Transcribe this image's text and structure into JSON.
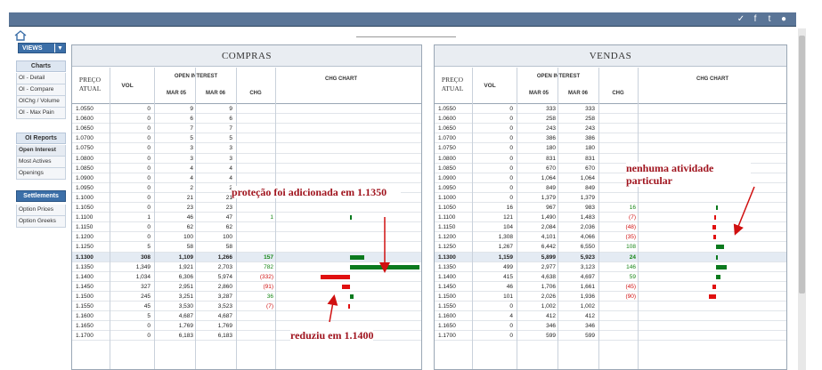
{
  "topbar": {
    "icons": [
      "check-icon",
      "facebook-icon",
      "twitter-icon",
      "rss-icon"
    ]
  },
  "sidebar": {
    "views_label": "VIEWS",
    "charts_head": "Charts",
    "charts": [
      "OI - Detail",
      "OI - Compare",
      "OIChg / Volume",
      "OI - Max Pain"
    ],
    "reports_head": "OI Reports",
    "reports": [
      "Open Interest",
      "Most Actives",
      "Openings"
    ],
    "settle_head": "Settlements",
    "settle": [
      "Option Prices",
      "Option Greeks"
    ]
  },
  "compras": {
    "title": "COMPRAS",
    "headers": {
      "preco": "PREÇO ATUAL",
      "vol": "VOL",
      "oi": "OPEN INTEREST",
      "m1": "MAR 05",
      "m2": "MAR 06",
      "chg": "CHG",
      "chart": "CHG CHART"
    },
    "rows": [
      [
        "1.0550",
        "0",
        "9",
        "9",
        ""
      ],
      [
        "1.0600",
        "0",
        "6",
        "6",
        ""
      ],
      [
        "1.0650",
        "0",
        "7",
        "7",
        ""
      ],
      [
        "1.0700",
        "0",
        "5",
        "5",
        ""
      ],
      [
        "1.0750",
        "0",
        "3",
        "3",
        ""
      ],
      [
        "1.0800",
        "0",
        "3",
        "3",
        ""
      ],
      [
        "1.0850",
        "0",
        "4",
        "4",
        ""
      ],
      [
        "1.0900",
        "0",
        "4",
        "4",
        ""
      ],
      [
        "1.0950",
        "0",
        "2",
        "2",
        ""
      ],
      [
        "1.1000",
        "0",
        "21",
        "21",
        ""
      ],
      [
        "1.1050",
        "0",
        "23",
        "23",
        ""
      ],
      [
        "1.1100",
        "1",
        "46",
        "47",
        "1"
      ],
      [
        "1.1150",
        "0",
        "62",
        "62",
        ""
      ],
      [
        "1.1200",
        "0",
        "100",
        "100",
        ""
      ],
      [
        "1.1250",
        "5",
        "58",
        "58",
        ""
      ],
      [
        "1.1300",
        "308",
        "1,109",
        "1,266",
        "157"
      ],
      [
        "1.1350",
        "1,349",
        "1,921",
        "2,703",
        "782"
      ],
      [
        "1.1400",
        "1,034",
        "6,306",
        "5,974",
        "(332)"
      ],
      [
        "1.1450",
        "327",
        "2,951",
        "2,860",
        "(91)"
      ],
      [
        "1.1500",
        "245",
        "3,251",
        "3,287",
        "36"
      ],
      [
        "1.1550",
        "45",
        "3,530",
        "3,523",
        "(7)"
      ],
      [
        "1.1600",
        "5",
        "4,687",
        "4,687",
        ""
      ],
      [
        "1.1650",
        "0",
        "1,769",
        "1,769",
        ""
      ],
      [
        "1.1700",
        "0",
        "6,183",
        "6,183",
        ""
      ]
    ],
    "chg_values": [
      0,
      0,
      0,
      0,
      0,
      0,
      0,
      0,
      0,
      0,
      0,
      1,
      0,
      0,
      0,
      157,
      782,
      -332,
      -91,
      36,
      -7,
      0,
      0,
      0
    ]
  },
  "vendas": {
    "title": "VENDAS",
    "headers": {
      "preco": "PREÇO ATUAL",
      "vol": "VOL",
      "oi": "OPEN INTEREST",
      "m1": "MAR 05",
      "m2": "MAR 06",
      "chg": "CHG",
      "chart": "CHG CHART"
    },
    "rows": [
      [
        "1.0550",
        "0",
        "333",
        "333",
        ""
      ],
      [
        "1.0600",
        "0",
        "258",
        "258",
        ""
      ],
      [
        "1.0650",
        "0",
        "243",
        "243",
        ""
      ],
      [
        "1.0700",
        "0",
        "386",
        "386",
        ""
      ],
      [
        "1.0750",
        "0",
        "180",
        "180",
        ""
      ],
      [
        "1.0800",
        "0",
        "831",
        "831",
        ""
      ],
      [
        "1.0850",
        "0",
        "670",
        "670",
        ""
      ],
      [
        "1.0900",
        "0",
        "1,064",
        "1,064",
        ""
      ],
      [
        "1.0950",
        "0",
        "849",
        "849",
        ""
      ],
      [
        "1.1000",
        "0",
        "1,379",
        "1,379",
        ""
      ],
      [
        "1.1050",
        "16",
        "967",
        "983",
        "16"
      ],
      [
        "1.1100",
        "121",
        "1,490",
        "1,483",
        "(7)"
      ],
      [
        "1.1150",
        "104",
        "2,084",
        "2,036",
        "(48)"
      ],
      [
        "1.1200",
        "1,308",
        "4,101",
        "4,066",
        "(35)"
      ],
      [
        "1.1250",
        "1,267",
        "6,442",
        "6,550",
        "108"
      ],
      [
        "1.1300",
        "1,159",
        "5,899",
        "5,923",
        "24"
      ],
      [
        "1.1350",
        "499",
        "2,977",
        "3,123",
        "146"
      ],
      [
        "1.1400",
        "415",
        "4,638",
        "4,697",
        "59"
      ],
      [
        "1.1450",
        "46",
        "1,706",
        "1,661",
        "(45)"
      ],
      [
        "1.1500",
        "101",
        "2,026",
        "1,936",
        "(90)"
      ],
      [
        "1.1550",
        "0",
        "1,002",
        "1,002",
        ""
      ],
      [
        "1.1600",
        "4",
        "412",
        "412",
        ""
      ],
      [
        "1.1650",
        "0",
        "346",
        "346",
        ""
      ],
      [
        "1.1700",
        "0",
        "599",
        "599",
        ""
      ]
    ],
    "chg_values": [
      0,
      0,
      0,
      0,
      0,
      0,
      0,
      0,
      0,
      0,
      16,
      -7,
      -48,
      -35,
      108,
      24,
      146,
      59,
      -45,
      -90,
      0,
      0,
      0,
      0
    ]
  },
  "current_row_index": 15,
  "annotations": {
    "protecao": "proteção foi adicionada em 1.1350",
    "reduziu": "reduziu em 1.1400",
    "nenhuma": "nenhuma atividade particular"
  }
}
